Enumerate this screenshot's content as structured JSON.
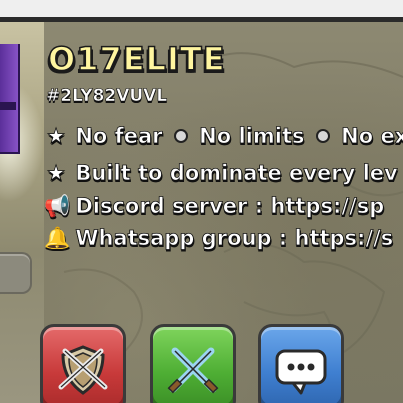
{
  "clan": {
    "name": "O17ELITE",
    "tag": "#2LY82VUVL"
  },
  "description": {
    "line1": {
      "icon": "★",
      "part1": "No fear",
      "part2": "No limits",
      "part3": "No exc"
    },
    "line2": {
      "icon": "★",
      "text": "Built to dominate every lev"
    },
    "line3": {
      "icon": "📢",
      "text": "Discord server : https://sp"
    },
    "line4": {
      "icon": "🔔",
      "text": "Whatsapp group : https://s"
    }
  },
  "buttons": {
    "war_icon": "shield-swords-icon",
    "friendly_icon": "crossed-swords-icon",
    "chat_icon": "chat-bubble-icon"
  },
  "colors": {
    "name_color": "#fff6a0",
    "war_button": "#c83a3a",
    "friendly_button": "#4eae34",
    "chat_button": "#3f7fd0"
  }
}
